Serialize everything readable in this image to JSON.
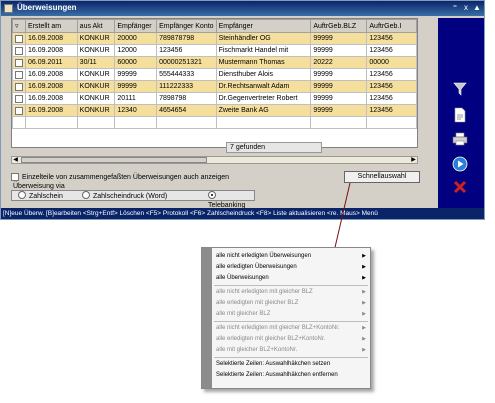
{
  "window": {
    "title": "Überweisungen",
    "title_buttons": [
      "⁼",
      "x",
      "▲"
    ]
  },
  "table": {
    "columns": [
      "Erstellt am",
      "aus Akt",
      "Empfänger",
      "Empfänger Konto",
      "Empfänger",
      "AuftrGeb.BLZ",
      "AuftrGeb.I"
    ],
    "rows": [
      {
        "date": "16.09.2008",
        "akt": "KONKUR",
        "emp": "20000",
        "konto": "789878798",
        "name": "Steinhändler OG",
        "blz": "99999",
        "ag": "123456",
        "highlight": true
      },
      {
        "date": "16.09.2008",
        "akt": "KONKUR",
        "emp": "12000",
        "konto": "123456",
        "name": "Fischmarkt Handel mit",
        "blz": "99999",
        "ag": "123456",
        "highlight": false
      },
      {
        "date": "06.09.2011",
        "akt": "30/11",
        "emp": "60000",
        "konto": "00000251321",
        "name": "Mustermann Thomas",
        "blz": "20222",
        "ag": "00000",
        "highlight": true
      },
      {
        "date": "16.09.2008",
        "akt": "KONKUR",
        "emp": "99999",
        "konto": "555444333",
        "name": "Diensthuber Alois",
        "blz": "99999",
        "ag": "123456",
        "highlight": false
      },
      {
        "date": "16.09.2008",
        "akt": "KONKUR",
        "emp": "99999",
        "konto": "111222333",
        "name": "Dr.Rechtsanwalt Adam",
        "blz": "99999",
        "ag": "123456",
        "highlight": true
      },
      {
        "date": "16.09.2008",
        "akt": "KONKUR",
        "emp": "20111",
        "konto": "7898798",
        "name": "Dr.Gegenvertreter Robert",
        "blz": "99999",
        "ag": "123456",
        "highlight": false
      },
      {
        "date": "16.09.2008",
        "akt": "KONKUR",
        "emp": "12340",
        "konto": "4654654",
        "name": "Zweite Bank AG",
        "blz": "99999",
        "ag": "123456",
        "highlight": true
      }
    ]
  },
  "status": {
    "found": "7 gefunden"
  },
  "options": {
    "show_combined": "Einzelteile von zusammengefaßten Überweisungen auch anzeigen",
    "via_label": "Überweisung via",
    "radios": [
      "Zahlschein",
      "Zahlscheindruck (Word)",
      "Telebanking"
    ],
    "selected": "Telebanking"
  },
  "buttons": {
    "quick_select": "Schnellauswahl"
  },
  "footer": "[N]eue Überw. [B]earbeiten <Strg+Entf> Löschen <F5> Protokoll <F6> Zahlscheindruck <F8> Liste aktualisieren <re. Maus> Menü",
  "sidebar": {
    "icons": [
      "funnel-icon",
      "document-icon",
      "printer-icon",
      "play-icon",
      "delete-x-icon"
    ],
    "colors": {
      "bg": "#000080",
      "funnel": "#c0c0c0",
      "play": "#2a7fd4",
      "delete": "#cc2222"
    }
  },
  "menu": {
    "items": [
      {
        "label": "alle nicht erledigten Überweisungen",
        "disabled": false,
        "submenu": true
      },
      {
        "label": "alle erledigten Überweisungen",
        "disabled": false,
        "submenu": true
      },
      {
        "label": "alle Überweisungen",
        "disabled": false,
        "submenu": true
      },
      {
        "label": "alle nicht erledigten mit gleicher BLZ",
        "disabled": true,
        "submenu": true
      },
      {
        "label": "alle erledigten mit gleicher BLZ",
        "disabled": true,
        "submenu": true
      },
      {
        "label": "alle mit gleicher BLZ",
        "disabled": true,
        "submenu": true
      },
      {
        "label": "alle nicht erledigten mit gleicher BLZ+KontoNr.",
        "disabled": true,
        "submenu": true
      },
      {
        "label": "alle erledigten mit gleicher BLZ+KontoNr.",
        "disabled": true,
        "submenu": true
      },
      {
        "label": "alle mit gleicher BLZ+KontoNr.",
        "disabled": true,
        "submenu": true
      },
      {
        "label": "Selektierte Zeilen: Auswahlhäkchen setzen",
        "disabled": false,
        "submenu": false
      },
      {
        "label": "Selektierte Zeilen: Auswahlhäkchen entfernen",
        "disabled": false,
        "submenu": false
      }
    ]
  }
}
